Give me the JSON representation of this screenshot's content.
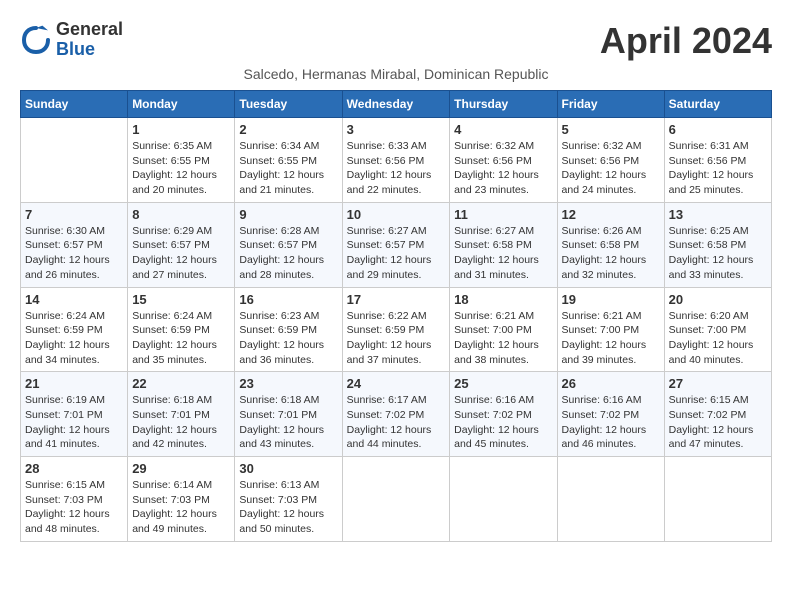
{
  "header": {
    "logo_general": "General",
    "logo_blue": "Blue",
    "month_title": "April 2024",
    "subtitle": "Salcedo, Hermanas Mirabal, Dominican Republic"
  },
  "weekdays": [
    "Sunday",
    "Monday",
    "Tuesday",
    "Wednesday",
    "Thursday",
    "Friday",
    "Saturday"
  ],
  "weeks": [
    [
      {
        "day": "",
        "sunrise": "",
        "sunset": "",
        "daylight": ""
      },
      {
        "day": "1",
        "sunrise": "Sunrise: 6:35 AM",
        "sunset": "Sunset: 6:55 PM",
        "daylight": "Daylight: 12 hours and 20 minutes."
      },
      {
        "day": "2",
        "sunrise": "Sunrise: 6:34 AM",
        "sunset": "Sunset: 6:55 PM",
        "daylight": "Daylight: 12 hours and 21 minutes."
      },
      {
        "day": "3",
        "sunrise": "Sunrise: 6:33 AM",
        "sunset": "Sunset: 6:56 PM",
        "daylight": "Daylight: 12 hours and 22 minutes."
      },
      {
        "day": "4",
        "sunrise": "Sunrise: 6:32 AM",
        "sunset": "Sunset: 6:56 PM",
        "daylight": "Daylight: 12 hours and 23 minutes."
      },
      {
        "day": "5",
        "sunrise": "Sunrise: 6:32 AM",
        "sunset": "Sunset: 6:56 PM",
        "daylight": "Daylight: 12 hours and 24 minutes."
      },
      {
        "day": "6",
        "sunrise": "Sunrise: 6:31 AM",
        "sunset": "Sunset: 6:56 PM",
        "daylight": "Daylight: 12 hours and 25 minutes."
      }
    ],
    [
      {
        "day": "7",
        "sunrise": "Sunrise: 6:30 AM",
        "sunset": "Sunset: 6:57 PM",
        "daylight": "Daylight: 12 hours and 26 minutes."
      },
      {
        "day": "8",
        "sunrise": "Sunrise: 6:29 AM",
        "sunset": "Sunset: 6:57 PM",
        "daylight": "Daylight: 12 hours and 27 minutes."
      },
      {
        "day": "9",
        "sunrise": "Sunrise: 6:28 AM",
        "sunset": "Sunset: 6:57 PM",
        "daylight": "Daylight: 12 hours and 28 minutes."
      },
      {
        "day": "10",
        "sunrise": "Sunrise: 6:27 AM",
        "sunset": "Sunset: 6:57 PM",
        "daylight": "Daylight: 12 hours and 29 minutes."
      },
      {
        "day": "11",
        "sunrise": "Sunrise: 6:27 AM",
        "sunset": "Sunset: 6:58 PM",
        "daylight": "Daylight: 12 hours and 31 minutes."
      },
      {
        "day": "12",
        "sunrise": "Sunrise: 6:26 AM",
        "sunset": "Sunset: 6:58 PM",
        "daylight": "Daylight: 12 hours and 32 minutes."
      },
      {
        "day": "13",
        "sunrise": "Sunrise: 6:25 AM",
        "sunset": "Sunset: 6:58 PM",
        "daylight": "Daylight: 12 hours and 33 minutes."
      }
    ],
    [
      {
        "day": "14",
        "sunrise": "Sunrise: 6:24 AM",
        "sunset": "Sunset: 6:59 PM",
        "daylight": "Daylight: 12 hours and 34 minutes."
      },
      {
        "day": "15",
        "sunrise": "Sunrise: 6:24 AM",
        "sunset": "Sunset: 6:59 PM",
        "daylight": "Daylight: 12 hours and 35 minutes."
      },
      {
        "day": "16",
        "sunrise": "Sunrise: 6:23 AM",
        "sunset": "Sunset: 6:59 PM",
        "daylight": "Daylight: 12 hours and 36 minutes."
      },
      {
        "day": "17",
        "sunrise": "Sunrise: 6:22 AM",
        "sunset": "Sunset: 6:59 PM",
        "daylight": "Daylight: 12 hours and 37 minutes."
      },
      {
        "day": "18",
        "sunrise": "Sunrise: 6:21 AM",
        "sunset": "Sunset: 7:00 PM",
        "daylight": "Daylight: 12 hours and 38 minutes."
      },
      {
        "day": "19",
        "sunrise": "Sunrise: 6:21 AM",
        "sunset": "Sunset: 7:00 PM",
        "daylight": "Daylight: 12 hours and 39 minutes."
      },
      {
        "day": "20",
        "sunrise": "Sunrise: 6:20 AM",
        "sunset": "Sunset: 7:00 PM",
        "daylight": "Daylight: 12 hours and 40 minutes."
      }
    ],
    [
      {
        "day": "21",
        "sunrise": "Sunrise: 6:19 AM",
        "sunset": "Sunset: 7:01 PM",
        "daylight": "Daylight: 12 hours and 41 minutes."
      },
      {
        "day": "22",
        "sunrise": "Sunrise: 6:18 AM",
        "sunset": "Sunset: 7:01 PM",
        "daylight": "Daylight: 12 hours and 42 minutes."
      },
      {
        "day": "23",
        "sunrise": "Sunrise: 6:18 AM",
        "sunset": "Sunset: 7:01 PM",
        "daylight": "Daylight: 12 hours and 43 minutes."
      },
      {
        "day": "24",
        "sunrise": "Sunrise: 6:17 AM",
        "sunset": "Sunset: 7:02 PM",
        "daylight": "Daylight: 12 hours and 44 minutes."
      },
      {
        "day": "25",
        "sunrise": "Sunrise: 6:16 AM",
        "sunset": "Sunset: 7:02 PM",
        "daylight": "Daylight: 12 hours and 45 minutes."
      },
      {
        "day": "26",
        "sunrise": "Sunrise: 6:16 AM",
        "sunset": "Sunset: 7:02 PM",
        "daylight": "Daylight: 12 hours and 46 minutes."
      },
      {
        "day": "27",
        "sunrise": "Sunrise: 6:15 AM",
        "sunset": "Sunset: 7:02 PM",
        "daylight": "Daylight: 12 hours and 47 minutes."
      }
    ],
    [
      {
        "day": "28",
        "sunrise": "Sunrise: 6:15 AM",
        "sunset": "Sunset: 7:03 PM",
        "daylight": "Daylight: 12 hours and 48 minutes."
      },
      {
        "day": "29",
        "sunrise": "Sunrise: 6:14 AM",
        "sunset": "Sunset: 7:03 PM",
        "daylight": "Daylight: 12 hours and 49 minutes."
      },
      {
        "day": "30",
        "sunrise": "Sunrise: 6:13 AM",
        "sunset": "Sunset: 7:03 PM",
        "daylight": "Daylight: 12 hours and 50 minutes."
      },
      {
        "day": "",
        "sunrise": "",
        "sunset": "",
        "daylight": ""
      },
      {
        "day": "",
        "sunrise": "",
        "sunset": "",
        "daylight": ""
      },
      {
        "day": "",
        "sunrise": "",
        "sunset": "",
        "daylight": ""
      },
      {
        "day": "",
        "sunrise": "",
        "sunset": "",
        "daylight": ""
      }
    ]
  ]
}
